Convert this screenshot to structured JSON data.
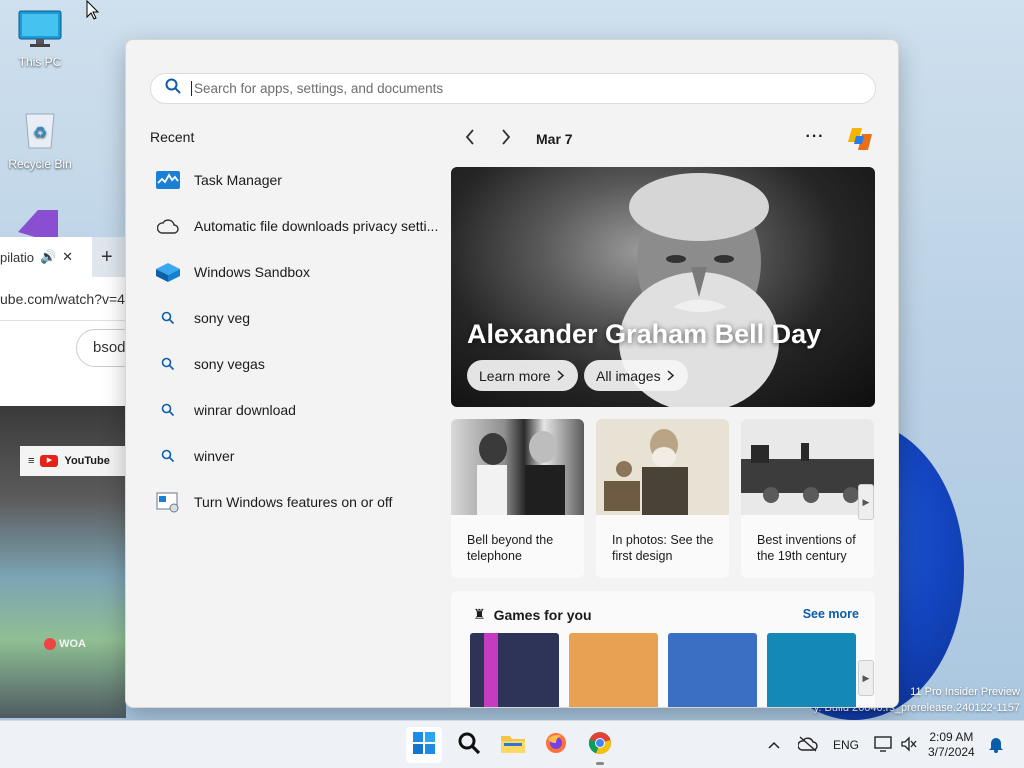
{
  "desktop": {
    "icons": [
      {
        "label": "This PC"
      },
      {
        "label": "Recycle Bin"
      }
    ],
    "watermark_line1": "11 Pro Insider Preview",
    "watermark_line2": "y. Build 26040.rs_prerelease.240122-1157"
  },
  "browser": {
    "tab_title": "pilatio",
    "address": "ube.com/watch?v=4",
    "search_value": "bsod",
    "yt_logo": "YouTube",
    "woa_label": "WOA"
  },
  "start_menu": {
    "search": {
      "placeholder": "Search for apps, settings, and documents"
    },
    "recent_heading": "Recent",
    "recent_items": [
      {
        "label": "Task Manager",
        "icon": "task-manager-icon"
      },
      {
        "label": "Automatic file downloads privacy setti...",
        "icon": "cloud-icon"
      },
      {
        "label": "Windows Sandbox",
        "icon": "sandbox-icon"
      },
      {
        "label": "sony veg",
        "icon": "search-icon"
      },
      {
        "label": "sony vegas",
        "icon": "search-icon"
      },
      {
        "label": "winrar download",
        "icon": "search-icon"
      },
      {
        "label": "winver",
        "icon": "search-icon"
      },
      {
        "label": "Turn Windows features on or off",
        "icon": "windows-features-icon"
      }
    ],
    "date": "Mar 7",
    "more_label": "···",
    "hero": {
      "title": "Alexander Graham Bell Day",
      "learn_more": "Learn more",
      "all_images": "All images"
    },
    "cards": [
      {
        "caption": "Bell beyond the telephone"
      },
      {
        "caption": "In photos: See the first design"
      },
      {
        "caption": "Best inventions of the 19th century"
      }
    ],
    "games": {
      "title": "Games for you",
      "see_more": "See more",
      "tile_colors": [
        "#2e3358",
        "#e8a153",
        "#3b6fc4",
        "#1489b8"
      ]
    }
  },
  "taskbar": {
    "language": "ENG",
    "time": "2:09 AM",
    "date": "3/7/2024",
    "apps": [
      "start-icon",
      "search-icon",
      "file-explorer-icon",
      "firefox-icon",
      "chrome-icon"
    ]
  }
}
